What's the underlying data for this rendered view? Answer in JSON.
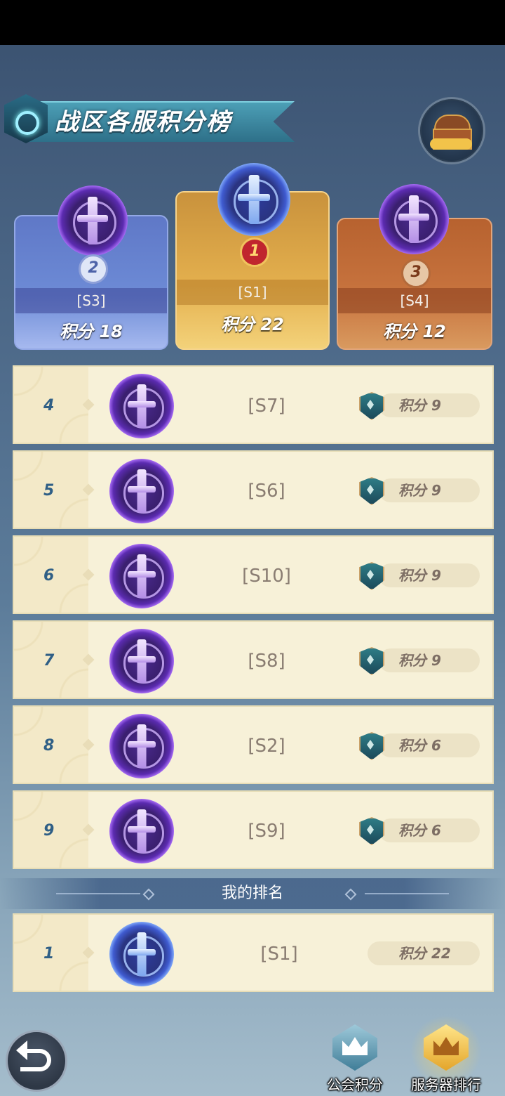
{
  "header": {
    "title": "战区各服积分榜"
  },
  "podium": [
    {
      "rank": "2",
      "server": "[S3]",
      "score": "积分 18",
      "emblem_color": "purple"
    },
    {
      "rank": "1",
      "server": "[S1]",
      "score": "积分 22",
      "emblem_color": "blue"
    },
    {
      "rank": "3",
      "server": "[S4]",
      "score": "积分 12",
      "emblem_color": "purple"
    }
  ],
  "list": [
    {
      "rank": "4",
      "server": "[S7]",
      "score": "积分 9"
    },
    {
      "rank": "5",
      "server": "[S6]",
      "score": "积分 9"
    },
    {
      "rank": "6",
      "server": "[S10]",
      "score": "积分 9"
    },
    {
      "rank": "7",
      "server": "[S8]",
      "score": "积分 9"
    },
    {
      "rank": "8",
      "server": "[S2]",
      "score": "积分 6"
    },
    {
      "rank": "9",
      "server": "[S9]",
      "score": "积分 6"
    }
  ],
  "my_ranking": {
    "label": "我的排名",
    "rank": "1",
    "server": "[S1]",
    "score": "积分 22"
  },
  "nav": {
    "guild_points": "公会积分",
    "server_ranking": "服务器排行"
  },
  "colors": {
    "rank_text": "#2f5f86",
    "row_bg": "#f7f1d8",
    "gold": "#e4b04e",
    "silver": "#6d8bd6",
    "bronze": "#c8743f"
  }
}
